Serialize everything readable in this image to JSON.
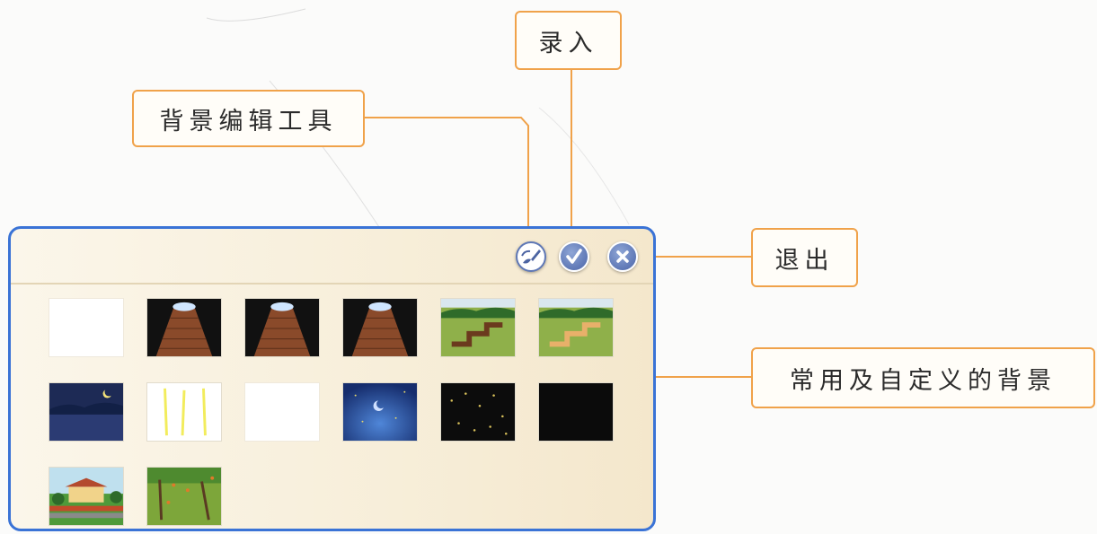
{
  "callouts": {
    "record": "录入",
    "background_editor": "背景编辑工具",
    "exit": "退出",
    "backgrounds": "常用及自定义的背景"
  },
  "toolbar": {
    "buttons": [
      {
        "name": "edit-background-button",
        "icon": "paint-brush-icon"
      },
      {
        "name": "confirm-button",
        "icon": "checkmark-icon"
      },
      {
        "name": "close-button",
        "icon": "close-x-icon"
      }
    ]
  },
  "backgrounds": [
    {
      "kind": "blank"
    },
    {
      "kind": "brick-stage"
    },
    {
      "kind": "brick-stage"
    },
    {
      "kind": "brick-stage"
    },
    {
      "kind": "grass-path-dark"
    },
    {
      "kind": "grass-path-light"
    },
    {
      "kind": "night-moon-lake"
    },
    {
      "kind": "yellow-lines"
    },
    {
      "kind": "blank"
    },
    {
      "kind": "blue-night-sky"
    },
    {
      "kind": "starry-black"
    },
    {
      "kind": "black"
    },
    {
      "kind": "house-garden"
    },
    {
      "kind": "orchard"
    }
  ],
  "colors": {
    "panel_border": "#3a73d6",
    "callout_border": "#f0a24a",
    "button_fill": "#5f78b6"
  }
}
